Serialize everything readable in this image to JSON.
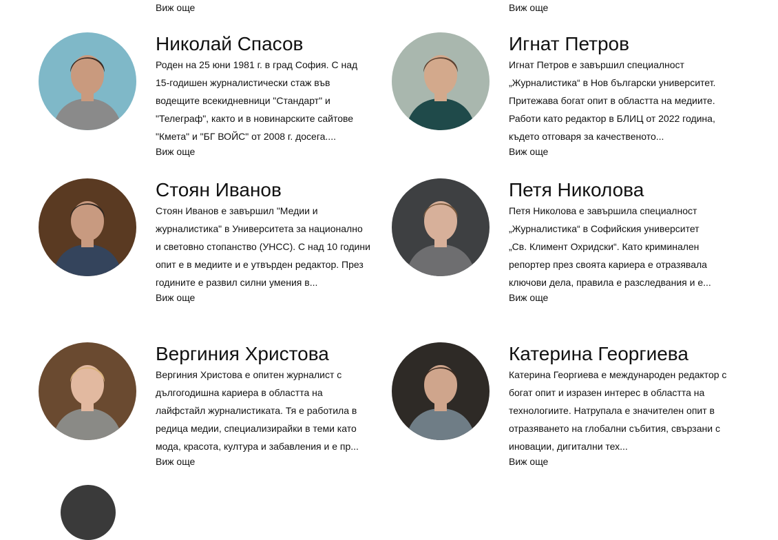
{
  "top_links": {
    "left": "Виж още",
    "right": "Виж още"
  },
  "people": [
    {
      "name": "Николай Спасов",
      "bio": "Роден на 25 юни 1981 г. в град София. С над 15-годишен журналистически стаж във водещите всекидневници \"Стандарт\" и \"Телеграф\", както и в новинарските сайтове \"Кмета\" и \"БГ ВОЙС\" от 2008 г. досега....",
      "more": "Виж още",
      "photo_colors": {
        "bg": "#7fb8c8",
        "skin": "#c99a7e",
        "hair": "#3a2a22",
        "cloth": "#8a8a8a"
      }
    },
    {
      "name": "Игнат Петров",
      "bio": "Игнат Петров е завършил специалност „Журналистика“ в Нов български университет. Притежава богат опит в областта на медиите. Работи като редактор в БЛИЦ от 2022 година, където отговаря за качественото...",
      "more": "Виж още",
      "photo_colors": {
        "bg": "#a9b7ae",
        "skin": "#d3a98c",
        "hair": "#5a4030",
        "cloth": "#1f4a4a"
      }
    },
    {
      "name": "Стоян Иванов",
      "bio": "Стоян Иванов е завършил \"Медии и журналистика\" в Университета за национално и световно стопанство (УНСС). С над 10 години опит е в медиите и е утвърден редактор. През годините е развил силни умения в...",
      "more": "Виж още",
      "photo_colors": {
        "bg": "#5a3a22",
        "skin": "#c89a80",
        "hair": "#2e2620",
        "cloth": "#34445c"
      }
    },
    {
      "name": "Петя Николова",
      "bio": "Петя Николова е завършила специалност „Журналистика“ в Софийския университет „Св. Климент Охридски“. Като криминален репортер през своята кариера е отразявала ключови дела, правила е разследвания и е...",
      "more": "Виж още",
      "photo_colors": {
        "bg": "#3e4042",
        "skin": "#d7b09a",
        "hair": "#7a5a3e",
        "cloth": "#6e6e70"
      }
    },
    {
      "name": "Вергиния Христова",
      "bio": "Вергиния Христова е опитен журналист с дългогодишна кариера в областта на лайфстайл журналистиката. Тя е работила в редица медии, специализирайки в теми като мода, красота, култура и забавления и е пр...",
      "more": "Виж още",
      "photo_colors": {
        "bg": "#6a4a30",
        "skin": "#e2b9a0",
        "hair": "#d9b27a",
        "cloth": "#8a8a86"
      }
    },
    {
      "name": "Катерина Георгиева",
      "bio": "Катерина Георгиева е международен редактор с богат опит и изразен интерес в областта на технологиите. Натрупала е значителен опит в отразяването на глобални събития, свързани с иновации, дигитални тех...",
      "more": "Виж още",
      "photo_colors": {
        "bg": "#2e2a26",
        "skin": "#cfa58c",
        "hair": "#3a2a20",
        "cloth": "#6f7d86"
      }
    }
  ]
}
